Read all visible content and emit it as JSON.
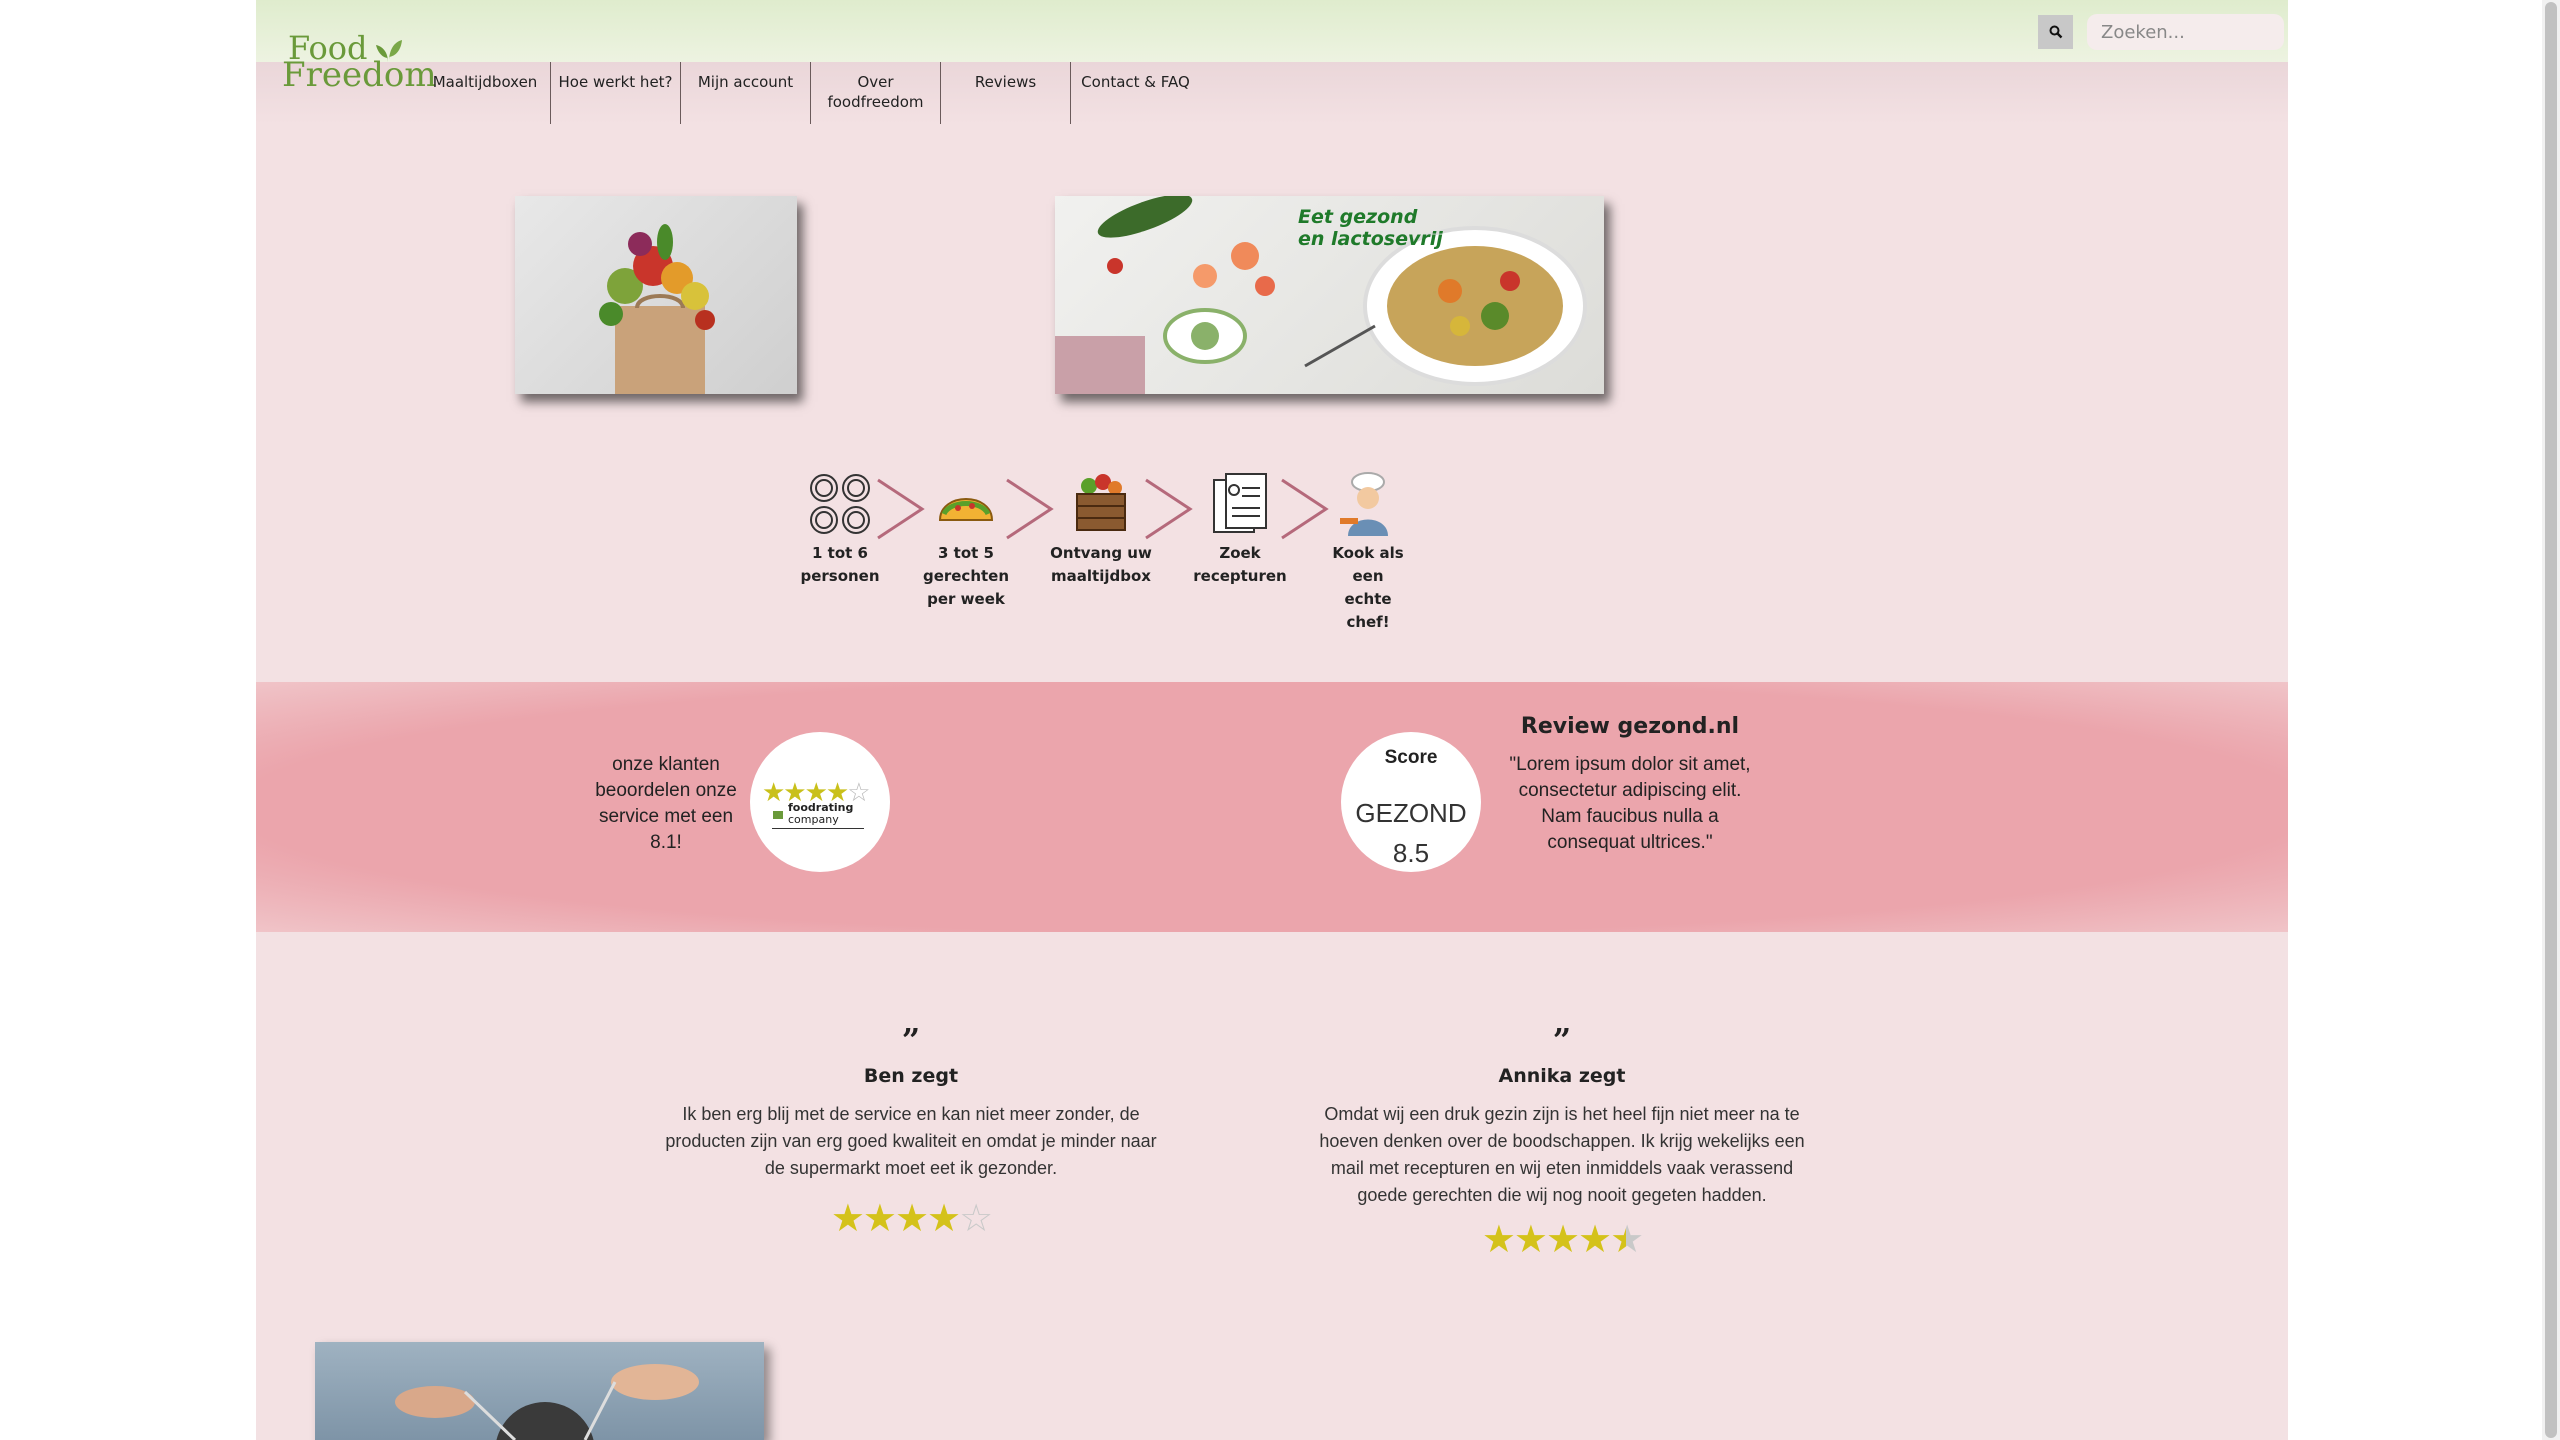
{
  "header": {
    "logo": {
      "line1": "Food",
      "line2": "Freedom"
    },
    "search": {
      "placeholder": "Zoeken...",
      "icon": "search-icon"
    },
    "nav": [
      {
        "label": "Maaltijdboxen"
      },
      {
        "label": "Hoe werkt het?"
      },
      {
        "label": "Mijn account"
      },
      {
        "label": "Over foodfreedom"
      },
      {
        "label": "Reviews"
      },
      {
        "label": "Contact & FAQ"
      }
    ]
  },
  "hero": {
    "bag_image": "groceries-bag-image",
    "dish_image": {
      "text_line1": "Eet gezond",
      "text_line2": "en lactosevrij"
    }
  },
  "steps": [
    {
      "icon": "plates-icon",
      "label": "1 tot 6 personen"
    },
    {
      "icon": "taco-icon",
      "label": "3 tot 5 gerechten per week"
    },
    {
      "icon": "veggie-crate-icon",
      "label": "Ontvang uw maaltijdbox"
    },
    {
      "icon": "recipe-book-icon",
      "label": "Zoek recepturen"
    },
    {
      "icon": "chef-icon",
      "label": "Kook als een echte chef!"
    }
  ],
  "ratings": {
    "customers_text": "onze klanten beoordelen onze service met een 8.1!",
    "badge": {
      "stars": 4,
      "max": 5,
      "brand_line1": "foodrating",
      "brand_line2": "company"
    },
    "score": {
      "title": "Score",
      "name": "GEZOND",
      "value": "8.5"
    },
    "review": {
      "title": "Review gezond.nl",
      "quote": "\"Lorem ipsum dolor sit amet, consectetur adipiscing elit. Nam faucibus nulla a consequat ultrices.\""
    }
  },
  "testimonials": [
    {
      "quote_mark": "”",
      "who": "Ben zegt",
      "text": "Ik ben erg blij met de service en kan niet meer zonder, de producten zijn van erg goed kwaliteit en omdat je minder naar de supermarkt moet eet ik gezonder.",
      "rating": 4,
      "max": 5
    },
    {
      "quote_mark": "”",
      "who": "Annika zegt",
      "text": "Omdat wij een druk gezin zijn is het heel fijn niet meer na te hoeven denken over de boodschappen. Ik krijg wekelijks een mail met recepturen en wij eten inmiddels vaak verassend goede gerechten die wij nog nooit gegeten hadden.",
      "rating": 4.5,
      "max": 5
    }
  ],
  "colors": {
    "page_bg": "#f3e1e3",
    "topbar": "#e4efd6",
    "band": "#eba5ac",
    "brand_green": "#6a9a3a",
    "star": "#d4c21a",
    "chevron": "#b5697b"
  }
}
